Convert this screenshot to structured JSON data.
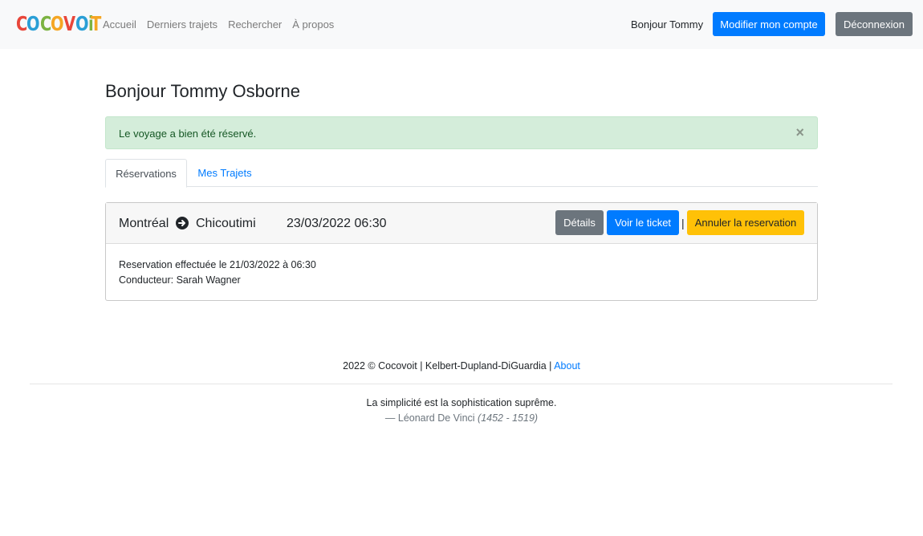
{
  "nav": {
    "logo_letters": [
      "C",
      "O",
      "C",
      "O",
      "V",
      "O",
      "i",
      "T"
    ],
    "logo_colors": [
      "#e8463a",
      "#2a9fd6",
      "#7cb342",
      "#f5a623",
      "#e8463a",
      "#2a9fd6",
      "#7cb342",
      "#f5a623"
    ],
    "links": [
      "Accueil",
      "Derniers trajets",
      "Rechercher",
      "À propos"
    ],
    "greeting": "Bonjour Tommy",
    "account_button": "Modifier mon compte",
    "logout_button": "Déconnexion"
  },
  "page": {
    "title": "Bonjour Tommy Osborne"
  },
  "alert": {
    "message": "Le voyage a bien été réservé.",
    "close": "×"
  },
  "tabs": {
    "reservations": "Réservations",
    "my_trips": "Mes Trajets"
  },
  "reservation": {
    "from": "Montréal",
    "to": "Chicoutimi",
    "datetime": "23/03/2022 06:30",
    "details_button": "Détails",
    "ticket_button": "Voir le ticket",
    "separator": "|",
    "cancel_button": "Annuler la reservation",
    "booked_line": "Reservation effectuée le 21/03/2022 à 06:30",
    "driver_line": "Conducteur: Sarah Wagner",
    "icon": "arrow-circle-right-icon"
  },
  "footer": {
    "copyright": "2022 © Cocovoit | Kelbert-Dupland-DiGuardia |",
    "about_link": "About",
    "quote": "La simplicité est la sophistication suprême.",
    "author": "— Léonard De Vinci",
    "author_dates": "(1452 - 1519)"
  },
  "colors": {
    "primary": "#007bff",
    "secondary": "#6c757d",
    "warning": "#ffc107",
    "success_bg": "#d4edda"
  }
}
